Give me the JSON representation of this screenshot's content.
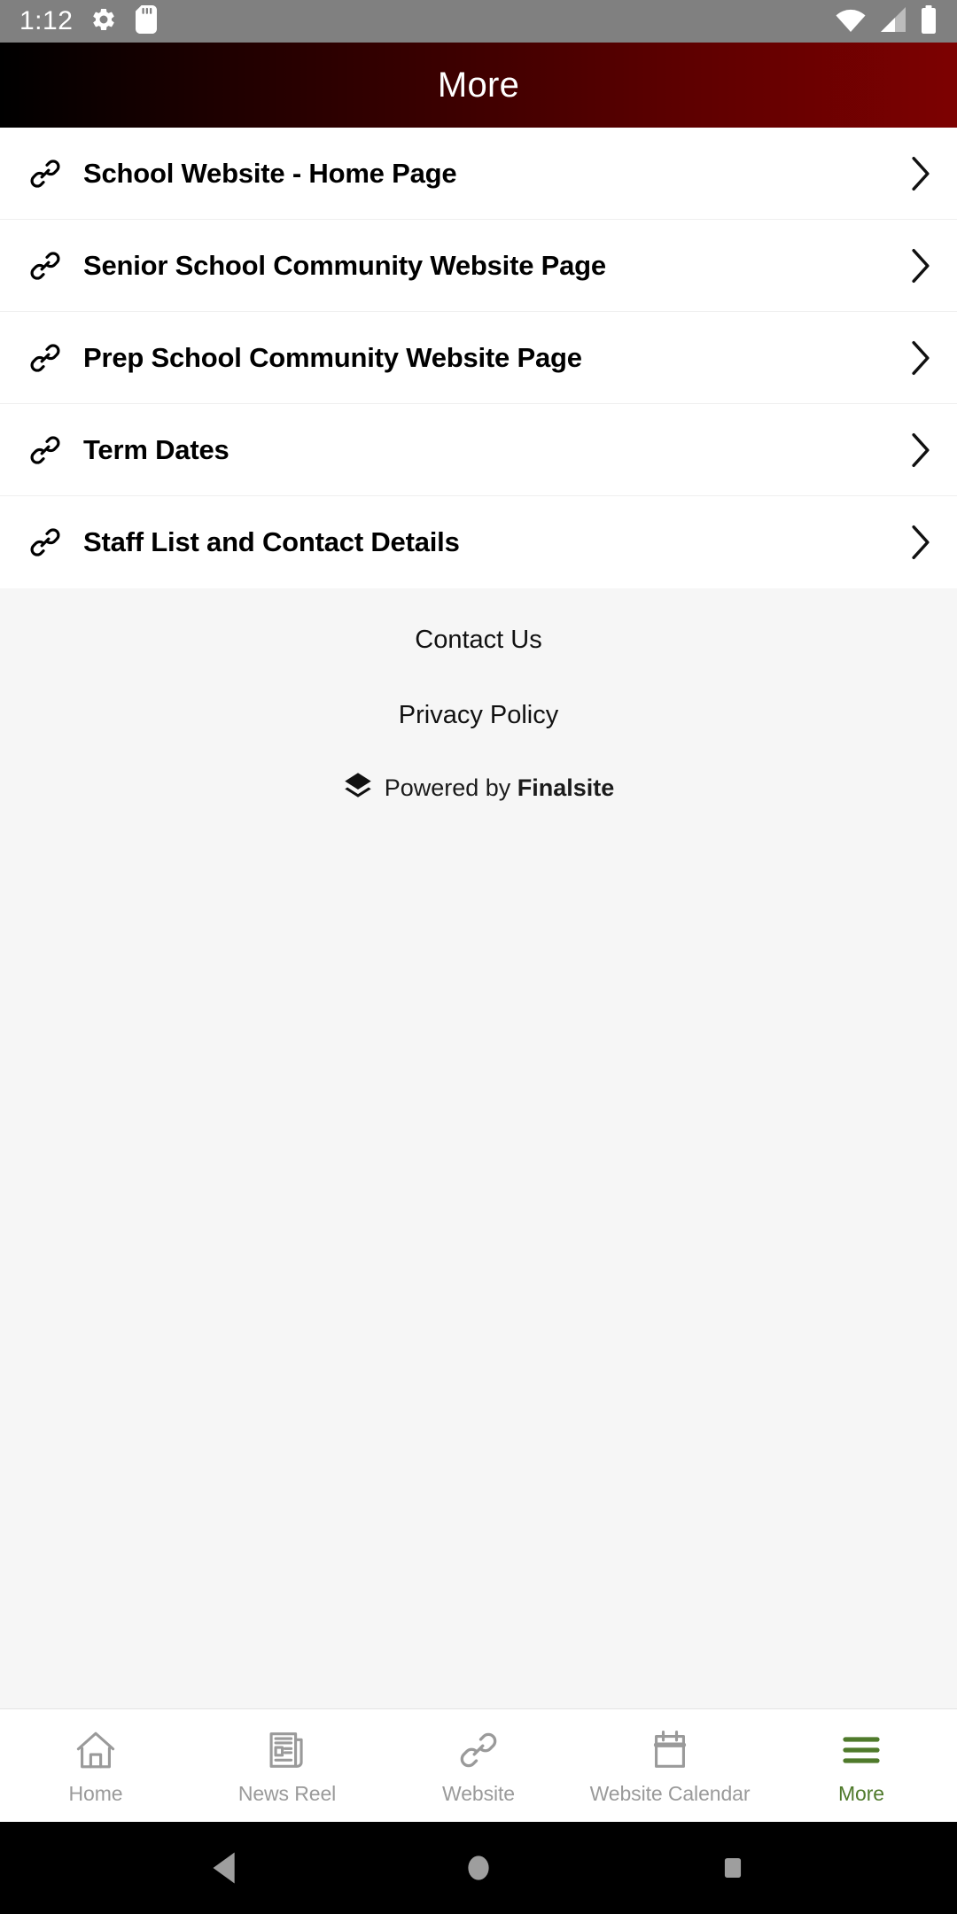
{
  "status_bar": {
    "time": "1:12",
    "left_icons": [
      "gear-icon",
      "sd-card-icon"
    ],
    "right_icons": [
      "wifi-icon",
      "cellular-signal-icon",
      "battery-icon"
    ],
    "background_color": "#808080",
    "foreground_color": "#ffffff"
  },
  "header": {
    "title": "More",
    "gradient_from": "#000000",
    "gradient_to": "#7d0101",
    "text_color": "#ffffff"
  },
  "list": {
    "items": [
      {
        "icon": "link-icon",
        "label": "School Website - Home Page",
        "chevron": "chevron-right-icon"
      },
      {
        "icon": "link-icon",
        "label": "Senior School Community Website Page",
        "chevron": "chevron-right-icon"
      },
      {
        "icon": "link-icon",
        "label": "Prep School Community Website Page",
        "chevron": "chevron-right-icon"
      },
      {
        "icon": "link-icon",
        "label": "Term Dates",
        "chevron": "chevron-right-icon"
      },
      {
        "icon": "link-icon",
        "label": "Staff List and Contact Details",
        "chevron": "chevron-right-icon"
      }
    ]
  },
  "footer": {
    "background_color": "#f6f6f6",
    "links": [
      {
        "label": "Contact Us"
      },
      {
        "label": "Privacy Policy"
      }
    ],
    "powered_by": {
      "prefix": "Powered by ",
      "brand": "Finalsite",
      "logo": "finalsite-layers-logo"
    }
  },
  "tab_bar": {
    "active_color": "#4f7a2b",
    "inactive_color": "#9a9a9a",
    "tabs": [
      {
        "label": "Home",
        "icon": "home-icon",
        "active": false
      },
      {
        "label": "News Reel",
        "icon": "newspaper-icon",
        "active": false
      },
      {
        "label": "Website",
        "icon": "link-icon",
        "active": false
      },
      {
        "label": "Website Calendar",
        "icon": "calendar-icon",
        "active": false
      },
      {
        "label": "More",
        "icon": "hamburger-menu-icon",
        "active": true
      }
    ]
  },
  "system_nav": {
    "background_color": "#000000",
    "buttons": [
      {
        "name": "back-button",
        "icon": "triangle-left-icon"
      },
      {
        "name": "home-button",
        "icon": "circle-icon"
      },
      {
        "name": "recents-button",
        "icon": "square-icon"
      }
    ]
  }
}
